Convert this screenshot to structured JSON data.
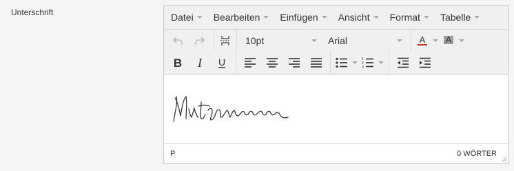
{
  "field": {
    "label": "Unterschrift"
  },
  "menubar": {
    "items": [
      {
        "label": "Datei"
      },
      {
        "label": "Bearbeiten"
      },
      {
        "label": "Einfügen"
      },
      {
        "label": "Ansicht"
      },
      {
        "label": "Format"
      },
      {
        "label": "Tabelle"
      }
    ]
  },
  "toolbar": {
    "font_size": "10pt",
    "font_family": "Arial",
    "icons": {
      "undo": "undo-icon",
      "redo": "redo-icon",
      "page_break": "page-break-icon",
      "text_color": "text-color-icon",
      "bg_color": "background-color-icon",
      "bold": "bold-icon",
      "italic": "italic-icon",
      "underline": "underline-icon",
      "align_left": "align-left-icon",
      "align_center": "align-center-icon",
      "align_right": "align-right-icon",
      "justify": "align-justify-icon",
      "bullet_list": "bullet-list-icon",
      "numbered_list": "numbered-list-icon",
      "outdent": "outdent-icon",
      "indent": "indent-icon"
    },
    "text_color_glyph": "A",
    "bg_color_glyph": "A",
    "bold_glyph": "B",
    "italic_glyph": "I",
    "underline_glyph": "U"
  },
  "statusbar": {
    "path": "P",
    "wordcount": "0 WÖRTER"
  },
  "colors": {
    "text_color_underline": "#c0392b",
    "bg_color_fill": "#9e9e9e",
    "menubar_bg": "#f0f0f0"
  }
}
